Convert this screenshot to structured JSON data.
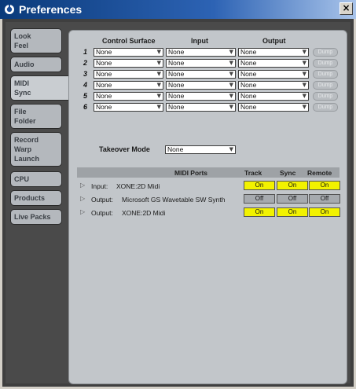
{
  "window": {
    "title": "Preferences",
    "close_glyph": "×",
    "logo_icon": "ableton-logo-icon",
    "close_icon": "close-icon"
  },
  "sidebar": {
    "tabs": [
      {
        "lines": [
          "Look",
          "Feel"
        ],
        "active": false
      },
      {
        "lines": [
          "Audio"
        ],
        "active": false
      },
      {
        "lines": [
          "MIDI",
          "Sync"
        ],
        "active": true
      },
      {
        "lines": [
          "File",
          "Folder"
        ],
        "active": false
      },
      {
        "lines": [
          "Record",
          "Warp",
          "Launch"
        ],
        "active": false
      },
      {
        "lines": [
          "CPU"
        ],
        "active": false
      },
      {
        "lines": [
          "Products"
        ],
        "active": false
      },
      {
        "lines": [
          "Live Packs"
        ],
        "active": false
      }
    ]
  },
  "midi": {
    "headers": {
      "control_surface": "Control Surface",
      "input": "Input",
      "output": "Output"
    },
    "rows": [
      {
        "num": "1",
        "surface": "None",
        "input": "None",
        "output": "None",
        "dump": "Dump"
      },
      {
        "num": "2",
        "surface": "None",
        "input": "None",
        "output": "None",
        "dump": "Dump"
      },
      {
        "num": "3",
        "surface": "None",
        "input": "None",
        "output": "None",
        "dump": "Dump"
      },
      {
        "num": "4",
        "surface": "None",
        "input": "None",
        "output": "None",
        "dump": "Dump"
      },
      {
        "num": "5",
        "surface": "None",
        "input": "None",
        "output": "None",
        "dump": "Dump"
      },
      {
        "num": "6",
        "surface": "None",
        "input": "None",
        "output": "None",
        "dump": "Dump"
      }
    ],
    "takeover": {
      "label": "Takeover Mode",
      "value": "None"
    },
    "ports": {
      "headers": {
        "ports": "MIDI Ports",
        "track": "Track",
        "sync": "Sync",
        "remote": "Remote"
      },
      "rows": [
        {
          "direction": "Input:",
          "name": "XONE:2D Midi",
          "track": "On",
          "sync": "On",
          "remote": "On"
        },
        {
          "direction": "Output:",
          "name": "Microsoft GS Wavetable SW Synth",
          "track": "Off",
          "sync": "Off",
          "remote": "Off"
        },
        {
          "direction": "Output:",
          "name": "XONE:2D Midi",
          "track": "On",
          "sync": "On",
          "remote": "On"
        }
      ]
    }
  },
  "colors": {
    "toggle_on": "#f2f200",
    "toggle_off": "#a6aaae",
    "panel_bg": "#c2c6ca",
    "title_bar": "#2d63b4"
  }
}
